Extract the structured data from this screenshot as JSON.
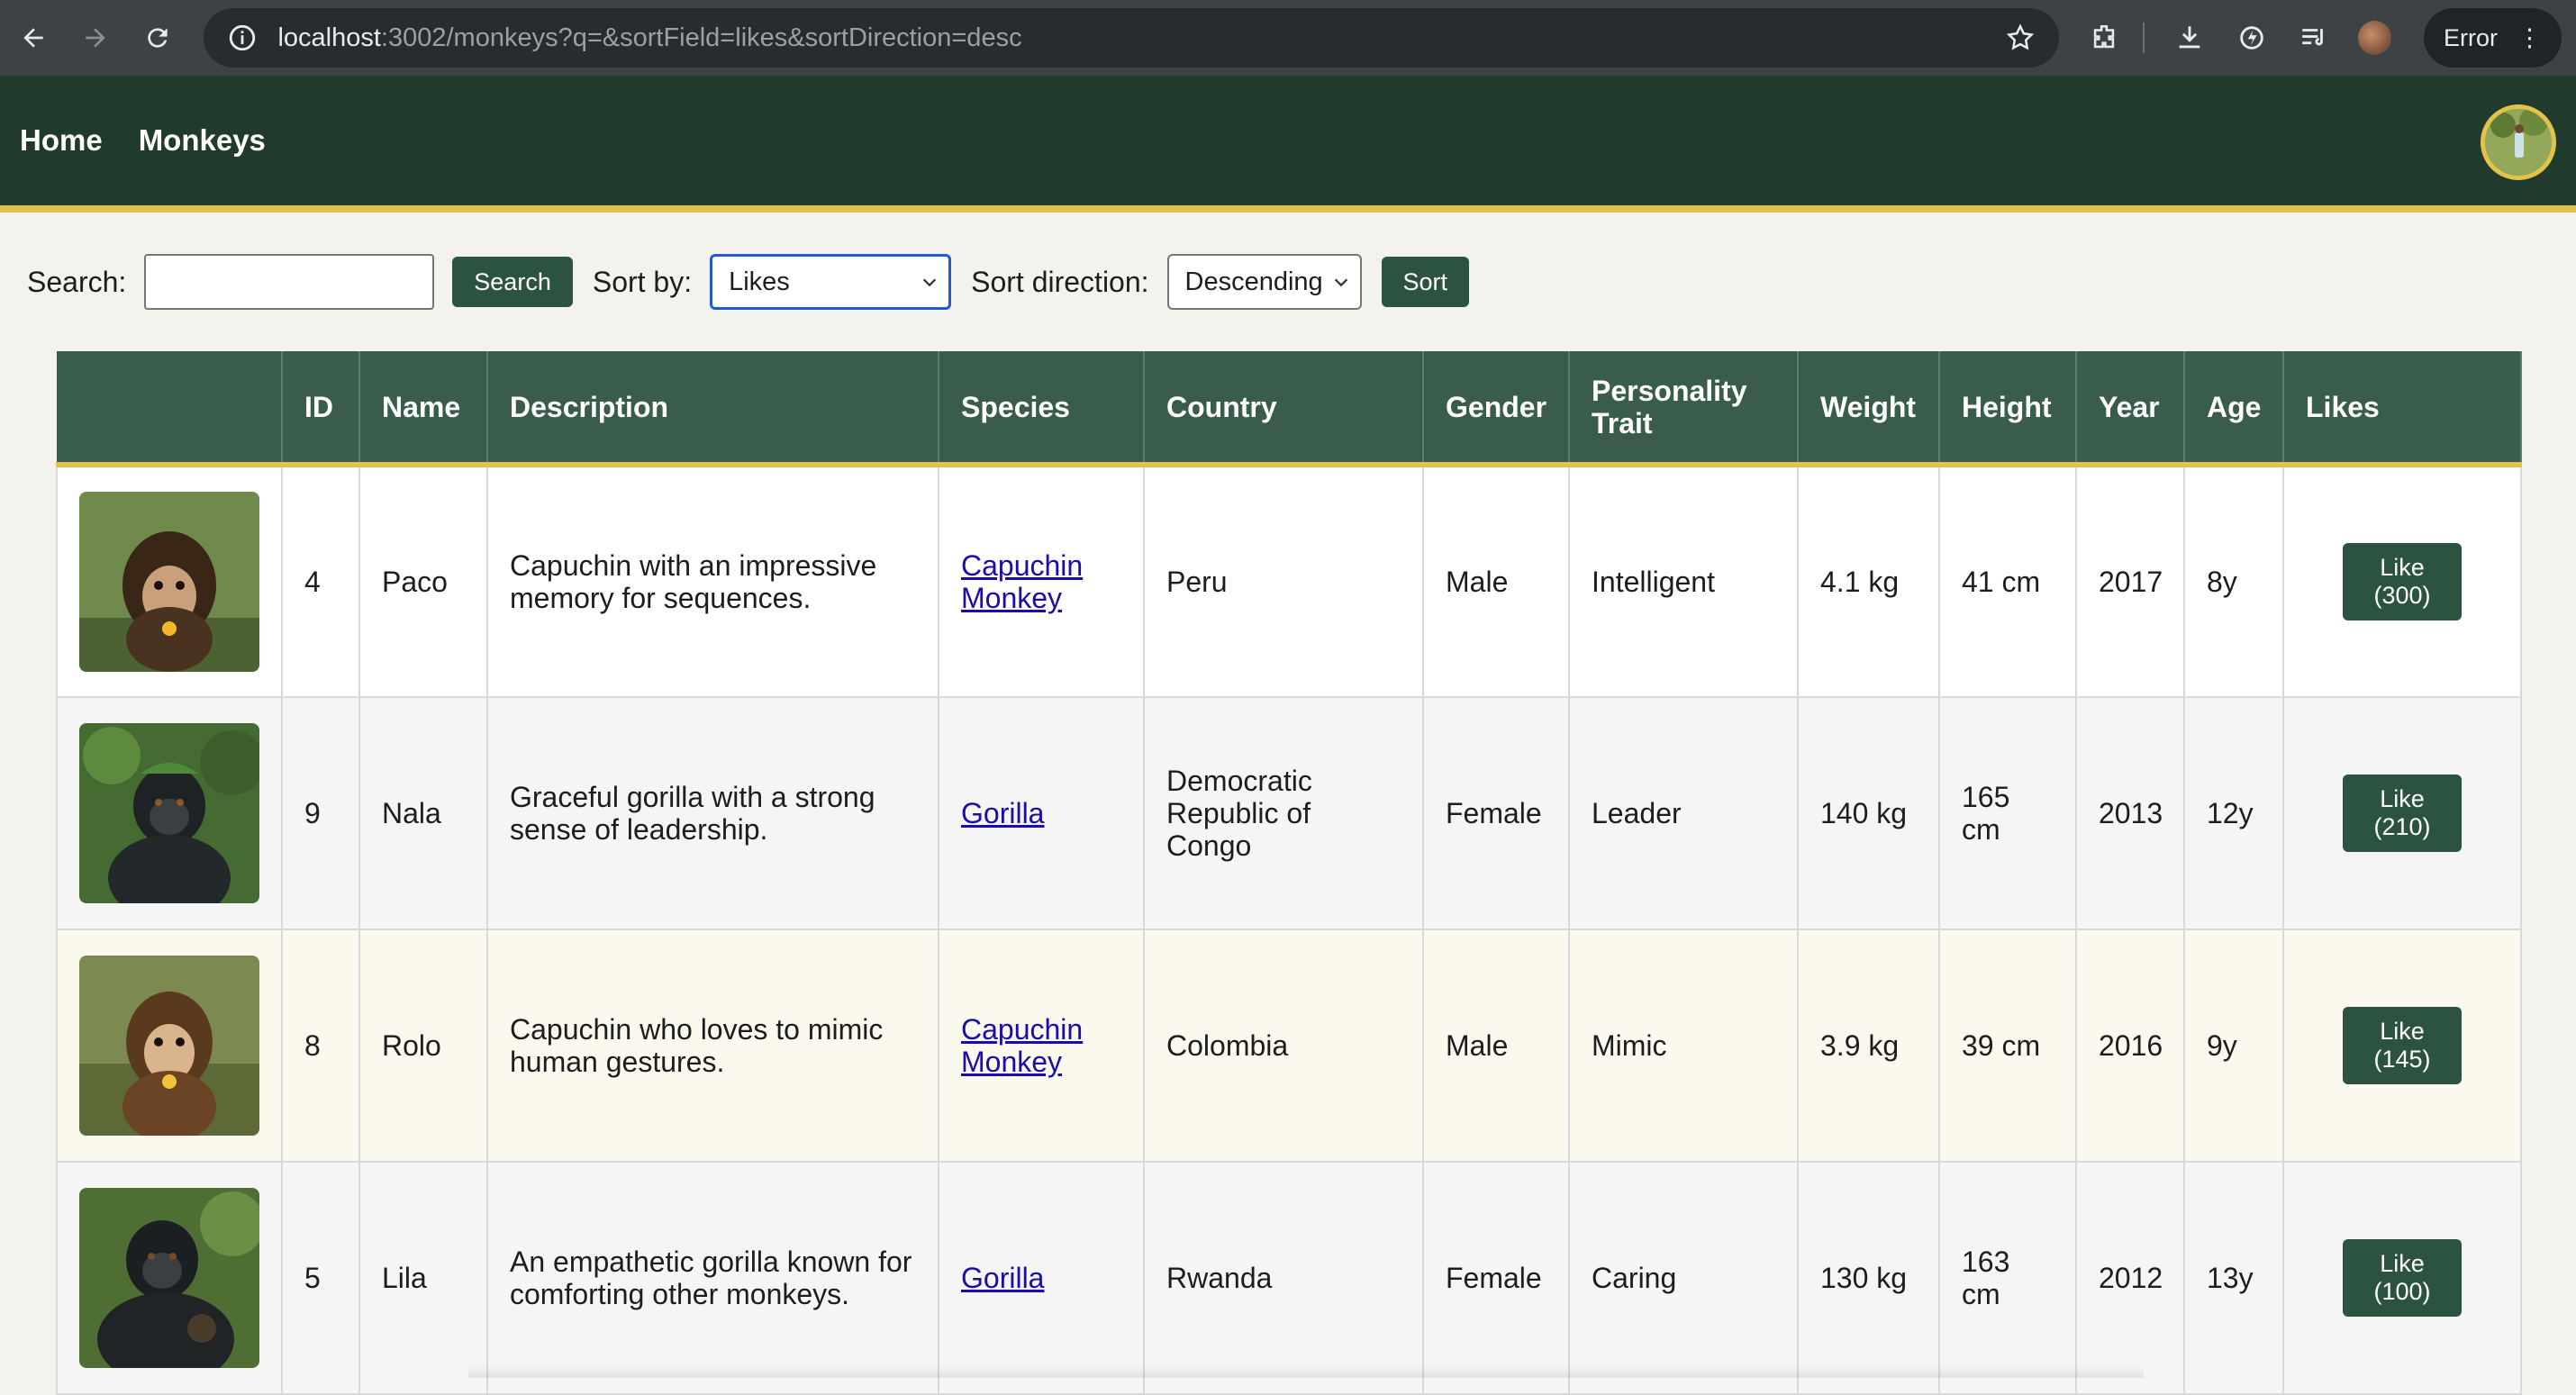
{
  "browser": {
    "url_host": "localhost",
    "url_rest": ":3002/monkeys?q=&sortField=likes&sortDirection=desc",
    "error_label": "Error"
  },
  "nav": {
    "home": "Home",
    "monkeys": "Monkeys"
  },
  "filters": {
    "search_label": "Search:",
    "search_value": "",
    "search_button": "Search",
    "sort_by_label": "Sort by:",
    "sort_by_value": "Likes",
    "sort_direction_label": "Sort direction:",
    "sort_direction_value": "Descending",
    "sort_button": "Sort"
  },
  "table": {
    "headers": [
      "",
      "ID",
      "Name",
      "Description",
      "Species",
      "Country",
      "Gender",
      "Personality Trait",
      "Weight",
      "Height",
      "Year",
      "Age",
      "Likes"
    ],
    "rows": [
      {
        "id": "4",
        "name": "Paco",
        "description": "Capuchin with an impressive memory for sequences.",
        "species": "Capuchin Monkey",
        "country": "Peru",
        "gender": "Male",
        "trait": "Intelligent",
        "weight": "4.1 kg",
        "height": "41 cm",
        "year": "2017",
        "age": "8y",
        "like_label": "Like",
        "like_count": "(300)"
      },
      {
        "id": "9",
        "name": "Nala",
        "description": "Graceful gorilla with a strong sense of leadership.",
        "species": "Gorilla",
        "country": "Democratic Republic of Congo",
        "gender": "Female",
        "trait": "Leader",
        "weight": "140 kg",
        "height": "165 cm",
        "year": "2013",
        "age": "12y",
        "like_label": "Like",
        "like_count": "(210)"
      },
      {
        "id": "8",
        "name": "Rolo",
        "description": "Capuchin who loves to mimic human gestures.",
        "species": "Capuchin Monkey",
        "country": "Colombia",
        "gender": "Male",
        "trait": "Mimic",
        "weight": "3.9 kg",
        "height": "39 cm",
        "year": "2016",
        "age": "9y",
        "like_label": "Like",
        "like_count": "(145)"
      },
      {
        "id": "5",
        "name": "Lila",
        "description": "An empathetic gorilla known for comforting other monkeys.",
        "species": "Gorilla",
        "country": "Rwanda",
        "gender": "Female",
        "trait": "Caring",
        "weight": "130 kg",
        "height": "163 cm",
        "year": "2012",
        "age": "13y",
        "like_label": "Like",
        "like_count": "(100)"
      }
    ]
  },
  "colors": {
    "header_bg": "#203a2c",
    "accent": "#e2c24a",
    "button": "#2c5340",
    "table_header": "#395c4b"
  }
}
